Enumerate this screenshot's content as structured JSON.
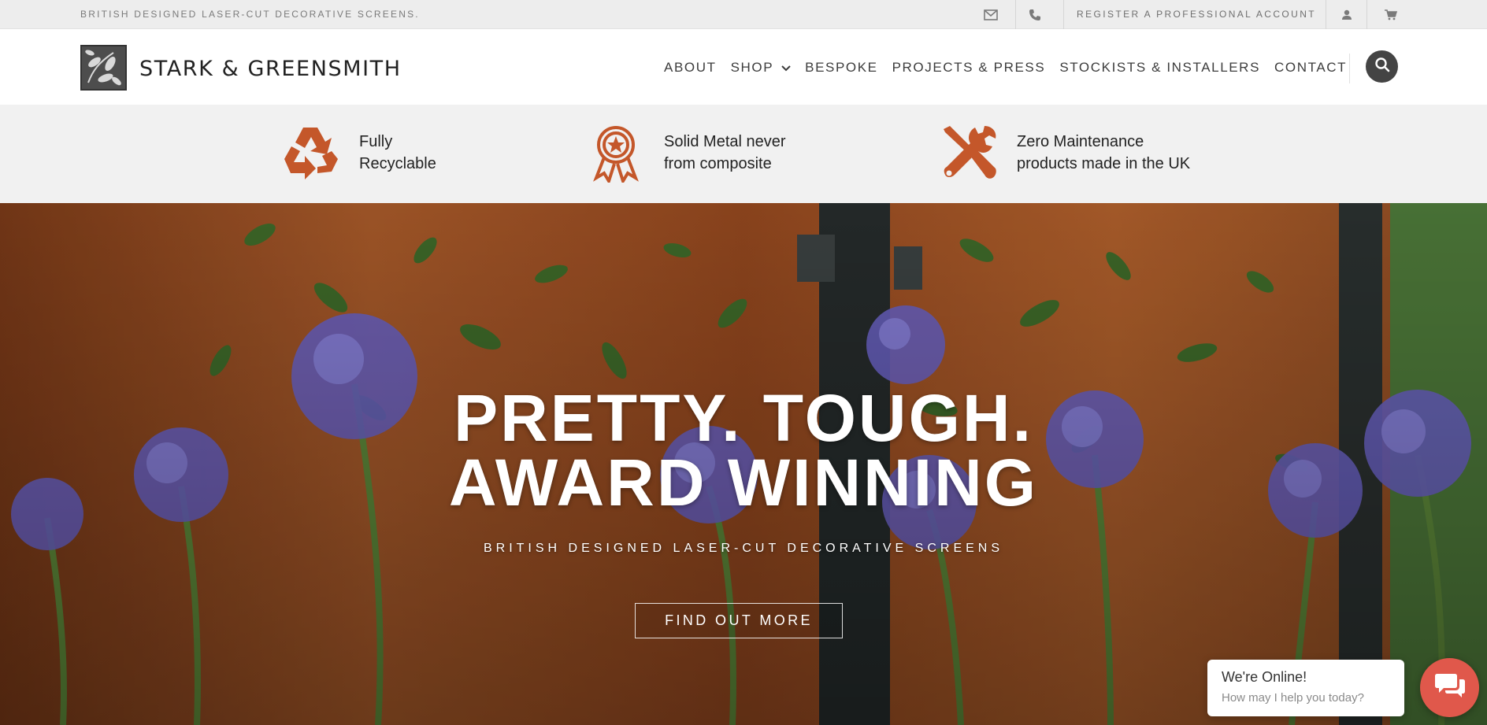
{
  "topbar": {
    "tagline": "BRITISH DESIGNED LASER-CUT DECORATIVE SCREENS.",
    "register_label": "REGISTER A PROFESSIONAL ACCOUNT",
    "icons": [
      "mail-icon",
      "phone-icon",
      "user-icon",
      "cart-icon"
    ]
  },
  "header": {
    "logo_text": "STARK & GREENSMITH",
    "nav": {
      "about": "ABOUT",
      "shop": "SHOP",
      "bespoke": "BESPOKE",
      "projects": "PROJECTS & PRESS",
      "stockists": "STOCKISTS & INSTALLERS",
      "contact": "CONTACT"
    },
    "search_icon": "search-icon"
  },
  "features": [
    {
      "icon": "recycle-icon",
      "line1": "Fully",
      "line2": "Recyclable"
    },
    {
      "icon": "award-icon",
      "line1": "Solid Metal never",
      "line2": "from composite"
    },
    {
      "icon": "tools-icon",
      "line1": "Zero Maintenance",
      "line2": "products made in the UK"
    }
  ],
  "hero": {
    "headline_line1": "PRETTY. TOUGH.",
    "headline_line2": "AWARD WINNING",
    "subtitle": "BRITISH DESIGNED LASER-CUT DECORATIVE SCREENS",
    "cta_label": "FIND OUT MORE"
  },
  "chat": {
    "title": "We're Online!",
    "subtitle": "How may I help you today?",
    "button_icon": "chat-icon"
  },
  "colors": {
    "accent": "#c4572a",
    "topbar_bg": "#ededed",
    "features_bg": "#f1f1f1",
    "chat_button": "#e0584b"
  }
}
